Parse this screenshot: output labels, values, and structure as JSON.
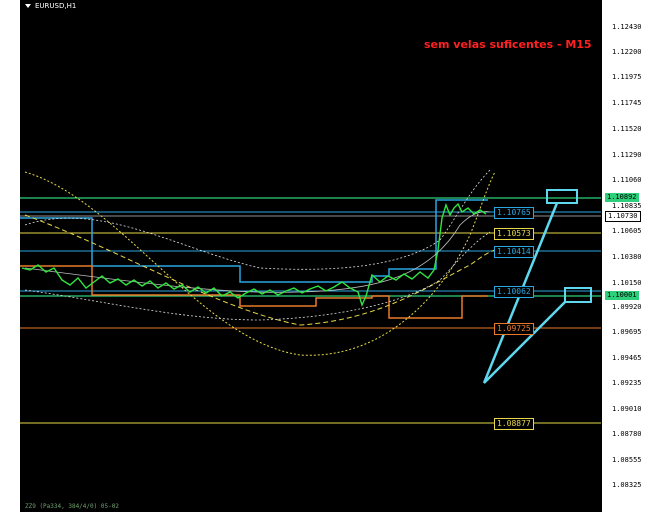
{
  "window": {
    "title": "EURUSD,H1",
    "message": "sem velas suficentes - M15",
    "footer": "ZZ9 (Pa334, 384/4/0) 05-02"
  },
  "price_axis": {
    "ticks": [
      "1.12430",
      "1.12200",
      "1.11975",
      "1.11745",
      "1.11520",
      "1.11290",
      "1.11060",
      "1.10835",
      "1.10605",
      "1.10380",
      "1.10150",
      "1.09920",
      "1.09695",
      "1.09465",
      "1.09235",
      "1.09010",
      "1.08780",
      "1.08555",
      "1.08325"
    ],
    "current_price": "1.10730",
    "highlight_price": "1.10892",
    "lowlight_price": "1.10001"
  },
  "levels": [
    {
      "name": "level-green-top",
      "value": "1.10892",
      "color": "#2ecf7a"
    },
    {
      "name": "level-blue-1",
      "value": "1.10765",
      "color": "#2aa6e0"
    },
    {
      "name": "level-yellow-1",
      "value": "1.10573",
      "color": "#e6d84a"
    },
    {
      "name": "level-blue-2",
      "value": "1.10414",
      "color": "#2aa6e0"
    },
    {
      "name": "level-blue-3",
      "value": "1.10062",
      "color": "#2aa6e0"
    },
    {
      "name": "level-green-bottom",
      "value": "1.10001",
      "color": "#2ecf7a"
    },
    {
      "name": "level-orange",
      "value": "1.09725",
      "color": "#e87a2a"
    },
    {
      "name": "level-yellow-2",
      "value": "1.08877",
      "color": "#e6d84a"
    }
  ],
  "colors": {
    "candle": "#2ee640",
    "arrow": "#5fd8ef",
    "message": "#ff2020"
  }
}
